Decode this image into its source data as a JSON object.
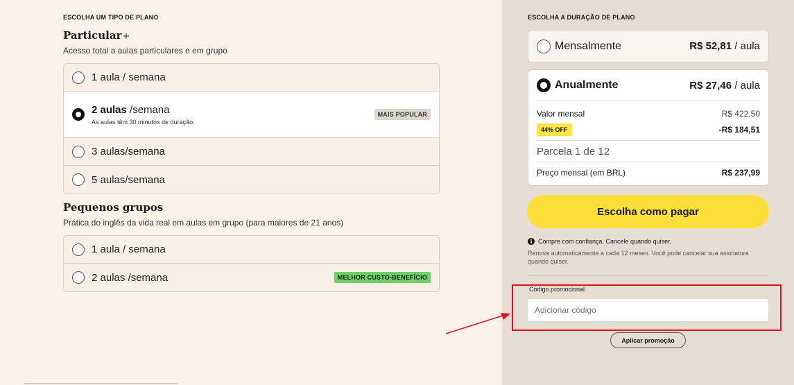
{
  "plan_type": {
    "eyebrow": "ESCOLHA UM TIPO DE PLANO",
    "particular": {
      "title": "Particular",
      "title_suffix": "+",
      "description": "Acesso total a aulas particulares e em grupo",
      "options": [
        {
          "label": "1 aula / semana",
          "selected": false
        },
        {
          "label_bold": "2 aulas",
          "label_rest": " /semana",
          "subtext": "As aulas têm 30 minutos de duração.",
          "badge": "MAIS POPULAR",
          "selected": true
        },
        {
          "label": "3 aulas/semana",
          "selected": false
        },
        {
          "label": "5 aulas/semana",
          "selected": false
        }
      ]
    },
    "groups": {
      "title": "Pequenos grupos",
      "description": "Prática do inglês da vida real em aulas em grupo (para maiores de 21 anos)",
      "options": [
        {
          "label": "1 aula / semana",
          "selected": false
        },
        {
          "label": "2 aulas /semana",
          "badge": "MELHOR CUSTO-BENEFÍCIO",
          "selected": false
        }
      ]
    }
  },
  "duration": {
    "eyebrow": "ESCOLHA A DURAÇÃO DE PLANO",
    "monthly": {
      "label": "Mensalmente",
      "price": "R$ 52,81",
      "unit": " / aula"
    },
    "annual": {
      "label": "Anualmente",
      "price": "R$ 27,46",
      "unit": " / aula",
      "monthly_value_label": "Valor mensal",
      "monthly_value": "R$ 422,50",
      "discount_badge": "44% OFF",
      "discount_value": "-R$ 184,51",
      "installment": "Parcela 1 de 12",
      "price_label": "Preço mensal (em BRL)",
      "price_value": "R$ 237,99"
    }
  },
  "checkout": {
    "pay_button": "Escolha como pagar",
    "trust_text": "Compre com confiança. Cancele quando quiser.",
    "renew_text": "Renova automaticamente a cada 12 meses. Você pode cancelar sua assinatura quando quiser.",
    "promo_label": "Código promocional",
    "promo_placeholder": "Adicionar código",
    "apply_button": "Aplicar promoção"
  },
  "colors": {
    "left_bg": "#faf1e8",
    "right_bg": "#e5ddd4",
    "pay_button": "#ffe03a",
    "highlight_box": "#e3141b",
    "best_value_badge": "#6fd06a"
  }
}
